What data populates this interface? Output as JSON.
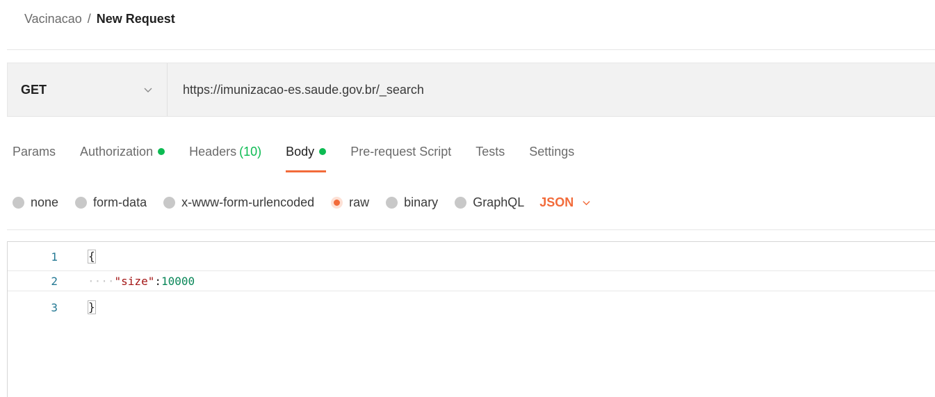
{
  "breadcrumb": {
    "collection": "Vacinacao",
    "separator": "/",
    "current": "New Request"
  },
  "request": {
    "method": "GET",
    "url": "https://imunizacao-es.saude.gov.br/_search"
  },
  "tabs": [
    {
      "label": "Params",
      "active": false
    },
    {
      "label": "Authorization",
      "indicator": "green-dot",
      "active": false
    },
    {
      "label": "Headers",
      "count": "(10)",
      "active": false
    },
    {
      "label": "Body",
      "indicator": "green-dot",
      "active": true
    },
    {
      "label": "Pre-request Script",
      "active": false
    },
    {
      "label": "Tests",
      "active": false
    },
    {
      "label": "Settings",
      "active": false
    }
  ],
  "body_types": [
    {
      "label": "none",
      "selected": false
    },
    {
      "label": "form-data",
      "selected": false
    },
    {
      "label": "x-www-form-urlencoded",
      "selected": false
    },
    {
      "label": "raw",
      "selected": true
    },
    {
      "label": "binary",
      "selected": false
    },
    {
      "label": "GraphQL",
      "selected": false
    }
  ],
  "language": "JSON",
  "editor": {
    "lines": [
      {
        "number": "1",
        "open_brace": "{"
      },
      {
        "number": "2",
        "indent": "····",
        "key": "\"size\"",
        "colon": ":",
        "value": "10000"
      },
      {
        "number": "3",
        "close_brace": "}"
      }
    ]
  },
  "colors": {
    "accent": "#f26b3a",
    "indicator_green": "#0cbb52",
    "line_number": "#237893",
    "json_key": "#a31515",
    "json_number": "#098658"
  }
}
